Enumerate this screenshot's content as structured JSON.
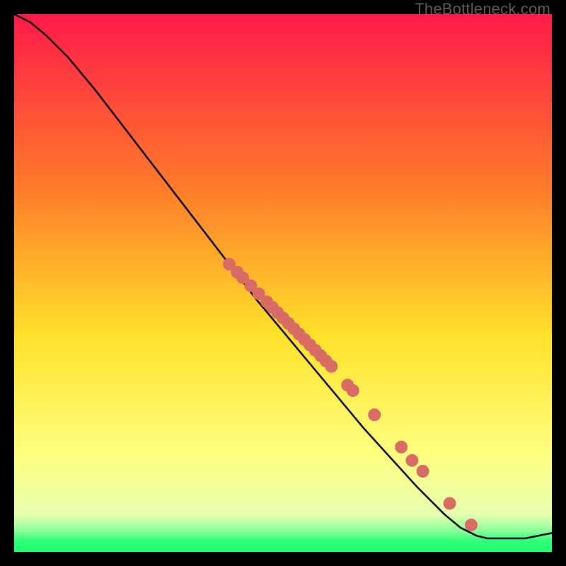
{
  "watermark": "TheBottleneck.com",
  "colors": {
    "gradient_top": "#ff1a4a",
    "gradient_mid1": "#ff7a2a",
    "gradient_mid2": "#ffe22a",
    "gradient_low": "#ffff99",
    "gradient_green": "#2eff7a",
    "curve": "#000000",
    "marker": "#d86b64",
    "bg": "#000000"
  },
  "chart_data": {
    "type": "line",
    "title": "",
    "xlabel": "",
    "ylabel": "",
    "xlim": [
      0,
      100
    ],
    "ylim": [
      0,
      100
    ],
    "curve": {
      "x": [
        0,
        3,
        6,
        10,
        15,
        20,
        25,
        30,
        35,
        40,
        45,
        50,
        55,
        60,
        65,
        70,
        75,
        80,
        83,
        86,
        88,
        90,
        95,
        100
      ],
      "y": [
        100,
        98.5,
        96,
        92,
        86,
        79.5,
        73,
        66.5,
        60,
        53.5,
        47,
        41,
        35,
        29,
        23,
        17.5,
        12,
        7,
        4.5,
        3,
        2.5,
        2.5,
        2.5,
        3.5
      ]
    },
    "markers": {
      "x": [
        40,
        41.5,
        42.5,
        44,
        45.5,
        47,
        48,
        49,
        50,
        51,
        52,
        53,
        54,
        55,
        56,
        57,
        58,
        59,
        62,
        63,
        67,
        72,
        74,
        76,
        81,
        85
      ],
      "y": [
        53.5,
        52,
        51,
        49.5,
        48,
        46.5,
        45.5,
        44.5,
        43.5,
        42.5,
        41.5,
        40.5,
        39.5,
        38.5,
        37.5,
        36.5,
        35.5,
        34.5,
        31,
        30,
        25.5,
        19.5,
        17,
        15,
        9,
        5
      ]
    }
  }
}
